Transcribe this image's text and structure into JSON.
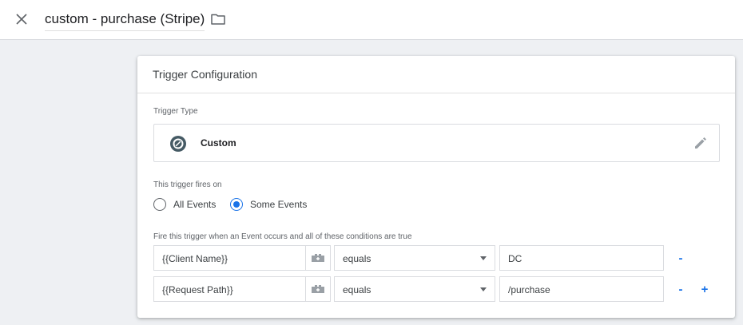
{
  "header": {
    "title": "custom - purchase (Stripe)",
    "close_icon": "close-icon",
    "folder_icon": "folder-icon"
  },
  "card": {
    "title": "Trigger Configuration",
    "trigger_type_label": "Trigger Type",
    "trigger_type": {
      "name": "Custom",
      "icon": "custom-trigger-icon",
      "edit_icon": "pencil-icon"
    },
    "fires_on_label": "This trigger fires on",
    "fires_on_options": [
      {
        "label": "All Events",
        "checked": false
      },
      {
        "label": "Some Events",
        "checked": true
      }
    ],
    "conditions_label": "Fire this trigger when an Event occurs and all of these conditions are true",
    "conditions": [
      {
        "variable": "{{Client Name}}",
        "operator": "equals",
        "value": "DC"
      },
      {
        "variable": "{{Request Path}}",
        "operator": "equals",
        "value": "/purchase"
      }
    ],
    "remove_label": "-",
    "add_label": "+"
  },
  "colors": {
    "accent": "#1a73e8",
    "background": "#eef0f3",
    "border": "#dadce0"
  }
}
